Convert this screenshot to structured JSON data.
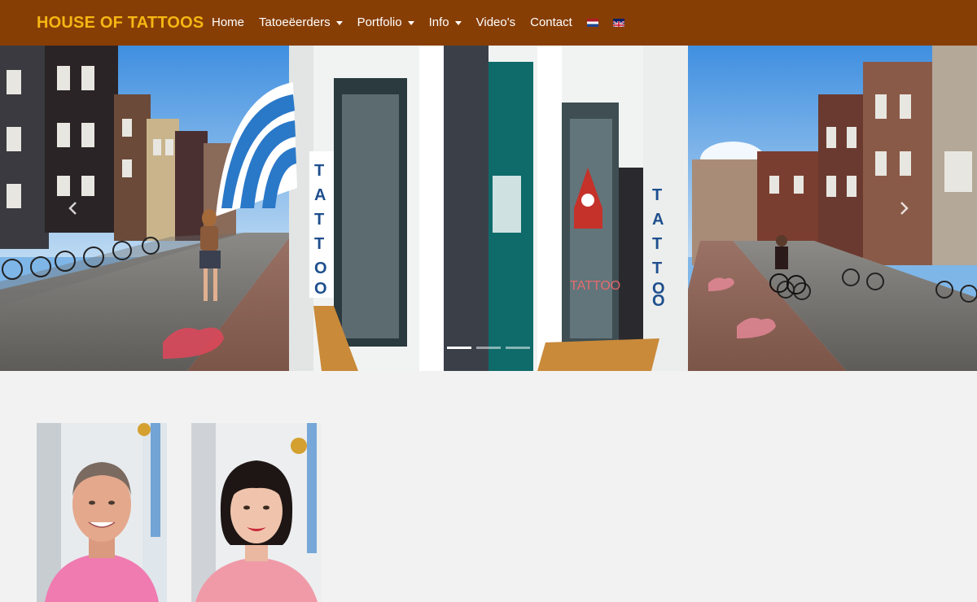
{
  "navbar": {
    "brand": "HOUSE OF TATTOOS",
    "items": [
      {
        "label": "Home",
        "dropdown": false
      },
      {
        "label": "Tatoeëerders",
        "dropdown": true
      },
      {
        "label": "Portfolio",
        "dropdown": true
      },
      {
        "label": "Info",
        "dropdown": true
      },
      {
        "label": "Video's",
        "dropdown": false
      },
      {
        "label": "Contact",
        "dropdown": false
      }
    ],
    "languages": [
      "nl-flag-icon",
      "uk-flag-icon"
    ]
  },
  "hero": {
    "slides_count": 3,
    "active_slide": 1,
    "storefront_sign": "TATTOO",
    "colors": {
      "sky": "#7fb6e8",
      "awning_blue": "#2a78c8",
      "heart": "#e0475a"
    }
  },
  "team": {
    "members": [
      {
        "icon": "man-portrait-photo"
      },
      {
        "icon": "woman-portrait-photo"
      }
    ]
  },
  "colors": {
    "navbar_bg": "#873e05",
    "brand": "#f6b614",
    "page_bg": "#f2f2f2"
  }
}
